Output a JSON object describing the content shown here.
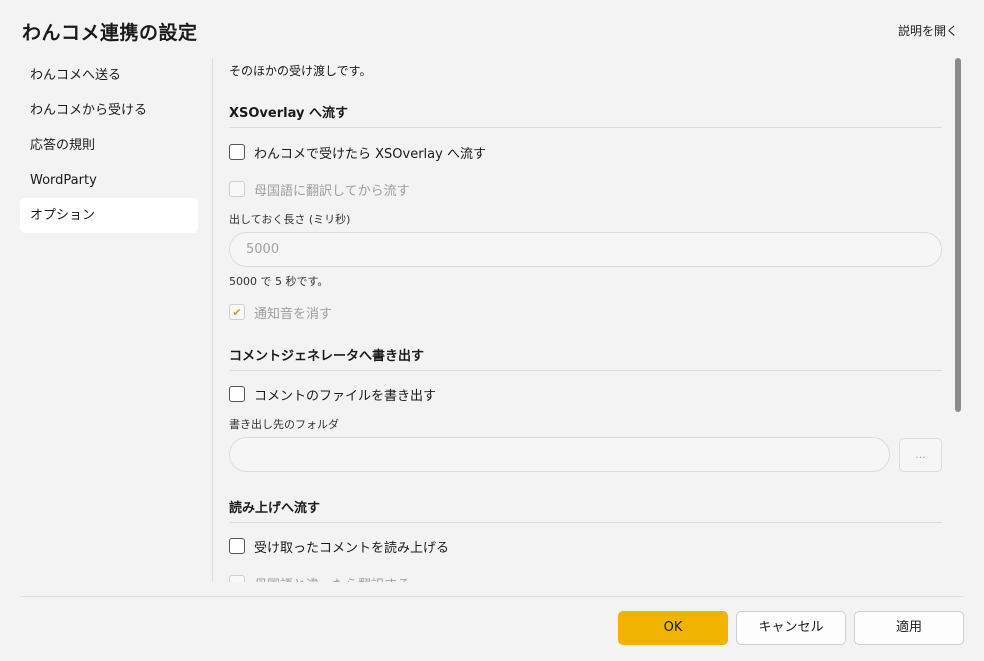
{
  "window": {
    "title": "わんコメ連携の設定",
    "help_link": "説明を開く"
  },
  "sidebar": {
    "items": [
      {
        "label": "わんコメへ送る",
        "active": false
      },
      {
        "label": "わんコメから受ける",
        "active": false
      },
      {
        "label": "応答の規則",
        "active": false
      },
      {
        "label": "WordParty",
        "active": false
      },
      {
        "label": "オプション",
        "active": true
      }
    ]
  },
  "content": {
    "intro": "そのほかの受け渡しです。",
    "xsoverlay": {
      "header": "XSOverlay へ流す",
      "flow_checkbox": {
        "label": "わんコメで受けたら XSOverlay へ流す",
        "checked": false
      },
      "translate_checkbox": {
        "label": "母国語に翻訳してから流す",
        "checked": false
      },
      "duration_label": "出しておく長さ (ミリ秒)",
      "duration_value": "5000",
      "duration_hint": "5000 で 5 秒です。",
      "mute_checkbox": {
        "label": "通知音を消す",
        "checked": true
      }
    },
    "comment_generator": {
      "header": "コメントジェネレータへ書き出す",
      "write_checkbox": {
        "label": "コメントのファイルを書き出す",
        "checked": false
      },
      "folder_label": "書き出し先のフォルダ",
      "folder_value": "",
      "browse_label": "..."
    },
    "read_aloud": {
      "header": "読み上げへ流す",
      "read_checkbox": {
        "label": "受け取ったコメントを読み上げる",
        "checked": false
      },
      "translate_checkbox": {
        "label": "母国語と違ったら翻訳する",
        "checked": false
      }
    }
  },
  "footer": {
    "ok_label": "OK",
    "cancel_label": "キャンセル",
    "apply_label": "適用"
  },
  "colors": {
    "accent": "#f0b400",
    "background": "#f3f3f3",
    "active_nav": "#ffffff"
  }
}
